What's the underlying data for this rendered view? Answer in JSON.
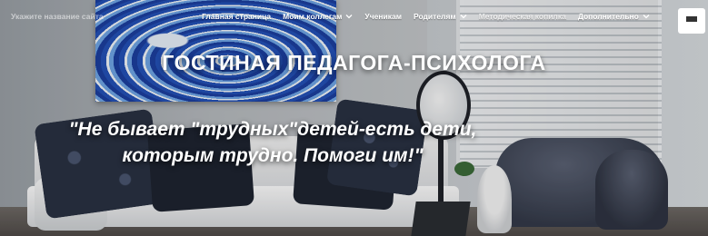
{
  "header": {
    "site_name": "Укажите название сайта",
    "menu": [
      {
        "label": "Главная страница",
        "has_dropdown": false
      },
      {
        "label": "Моим коллегам",
        "has_dropdown": true
      },
      {
        "label": "Ученикам",
        "has_dropdown": false
      },
      {
        "label": "Родителям",
        "has_dropdown": true
      },
      {
        "label": "Методическая копилка",
        "has_dropdown": false
      },
      {
        "label": "Дополнительно",
        "has_dropdown": true
      }
    ],
    "menu_toggle_icon": "hamburger-icon"
  },
  "hero": {
    "title": "ГОСТИНАЯ ПЕДАГОГА-ПСИХОЛОГА",
    "quote_line1": "\"Не бывает \"трудных\"детей-есть дети,",
    "quote_line2": "которым трудно. Помоги им!\""
  },
  "colors": {
    "text": "#ffffff",
    "toggle_bg": "#ffffff"
  }
}
